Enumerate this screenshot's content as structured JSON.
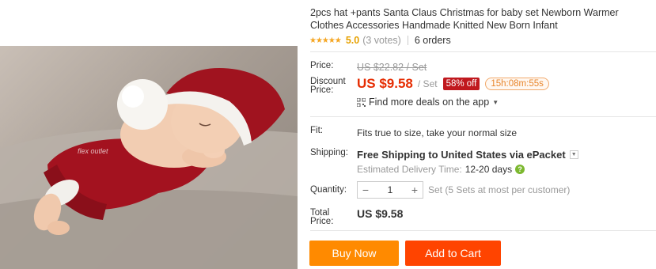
{
  "product": {
    "title": "2pcs hat +pants Santa Claus Christmas for baby set Newborn Warmer Clothes Accessories Handmade Knitted New Born Infant",
    "stars": "★★★★★",
    "score": "5.0",
    "votes": "(3 votes)",
    "orders": "6 orders"
  },
  "price": {
    "price_label": "Price:",
    "original": "US $22.82 / Set",
    "discount_label_1": "Discount",
    "discount_label_2": "Price:",
    "current": "US $9.58",
    "unit": "/ Set",
    "off_badge": "58% off",
    "countdown": "15h:08m:55s",
    "app_deals": "Find more deals on the app"
  },
  "details": {
    "fit_label": "Fit:",
    "fit_text": "Fits true to size, take your normal size",
    "shipping_label": "Shipping:",
    "shipping_text": "Free Shipping to United States via ePacket",
    "delivery_label": "Estimated Delivery Time:",
    "delivery_days": "12-20 days",
    "quantity_label": "Quantity:",
    "quantity_value": "1",
    "minus": "−",
    "plus": "+",
    "stock_text": "Set (5 Sets at most per customer)",
    "total_label_1": "Total",
    "total_label_2": "Price:",
    "total_value": "US $9.58"
  },
  "actions": {
    "buy_now": "Buy Now",
    "add_to_cart": "Add to Cart"
  },
  "image": {
    "watermark": "flex outlet"
  },
  "colors": {
    "price_red": "#e62e04",
    "buy_now_orange": "#ff8a00",
    "add_to_cart_red": "#ff4400",
    "star_gold": "#f5a623"
  }
}
